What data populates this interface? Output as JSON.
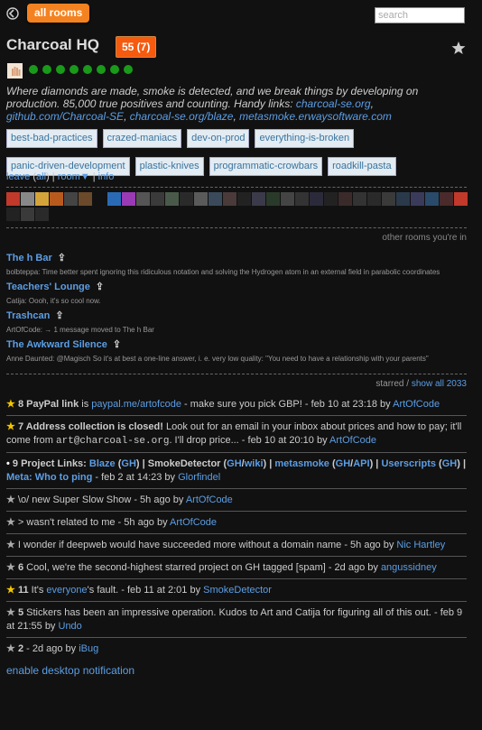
{
  "topbar": {
    "all_rooms_label": "all rooms",
    "search_placeholder": "search"
  },
  "room": {
    "title": "Charcoal HQ",
    "badge": "55 (7)",
    "description": "Where diamonds are made, smoke is detected, and we break things by developing on production. 85,000 true positives and counting. Handy links: ",
    "desc_links": [
      "charcoal-se.org",
      "github.com/Charcoal-SE",
      "charcoal-se.org/blaze",
      "metasmoke.erwaysoftware.com"
    ],
    "tags": [
      "best-bad-practices",
      "crazed-maniacs",
      "dev-on-prod",
      "everything-is-broken",
      "panic-driven-development",
      "plastic-knives",
      "programmatic-crowbars",
      "roadkill-pasta"
    ],
    "leave_label": "leave",
    "leave_all_label": "all",
    "room_menu_label": "room▼",
    "info_label": "info"
  },
  "other_rooms": {
    "label": "other rooms you're in",
    "rooms": [
      {
        "name": "The h Bar",
        "last": "bolbteppa: Time better spent ignoring this ridiculous notation and solving the Hydrogen atom in an external field in parabolic coordinates"
      },
      {
        "name": "Teachers' Lounge",
        "last": "Catija: Oooh, it's so cool now."
      },
      {
        "name": "Trashcan",
        "last": "ArtOfCode: → 1 message moved to The h Bar"
      },
      {
        "name": "The Awkward Silence",
        "last": "Anne Daunted: @Magisch So it's at best a one-line answer, i. e. very low quality: \"You need to have a relationship with your parents\""
      }
    ]
  },
  "starred": {
    "label_starred": "starred",
    "label_show_all": "show all 2033",
    "enable_notifications": "enable desktop notification"
  },
  "colors": {
    "accent": "#f58220",
    "badge": "#f55a0e",
    "link": "#5c9ee5",
    "star": "#f2c500",
    "online": "#1a9a1a"
  }
}
